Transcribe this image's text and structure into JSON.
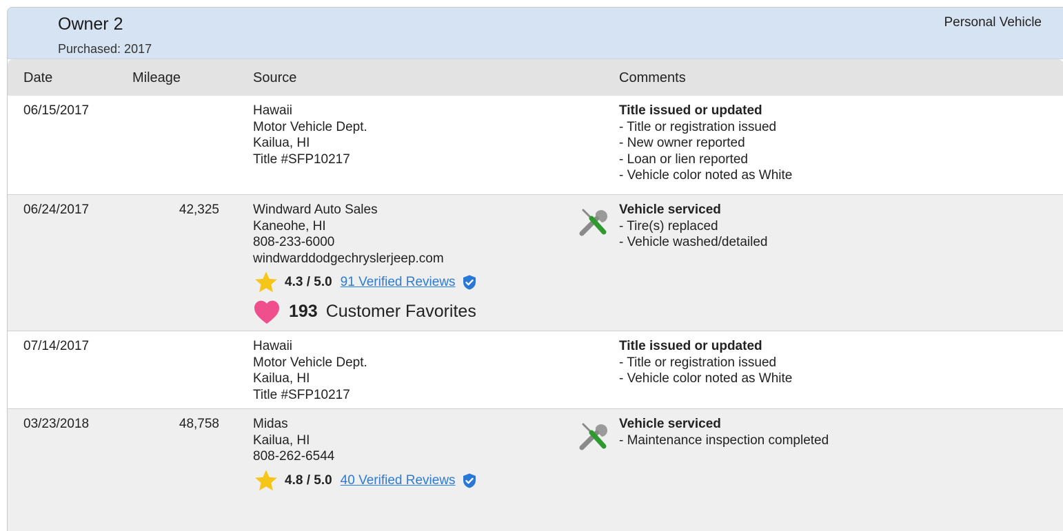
{
  "owner": {
    "title": "Owner 2",
    "purchased": "Purchased: 2017",
    "type": "Personal Vehicle"
  },
  "columns": {
    "date": "Date",
    "mileage": "Mileage",
    "source": "Source",
    "comments": "Comments"
  },
  "rows": [
    {
      "date": "06/15/2017",
      "mileage": "",
      "source": [
        "Hawaii",
        "Motor Vehicle Dept.",
        "Kailua, HI",
        "Title #SFP10217"
      ],
      "comment_title": "Title issued or updated",
      "comments": [
        "- Title or registration issued",
        "- New owner reported",
        "- Loan or lien reported",
        "- Vehicle color noted as White"
      ]
    },
    {
      "date": "06/24/2017",
      "mileage": "42,325",
      "source": [
        "Windward Auto Sales",
        "Kaneohe, HI",
        "808-233-6000",
        "windwarddodgechryslerjeep.com"
      ],
      "rating": "4.3 / 5.0",
      "reviews": "91 Verified Reviews",
      "favorites_count": "193",
      "favorites_label": "Customer Favorites",
      "comment_title": "Vehicle serviced",
      "comments": [
        "- Tire(s) replaced",
        "- Vehicle washed/detailed"
      ],
      "icon": "wrench-screwdriver-icon"
    },
    {
      "date": "07/14/2017",
      "mileage": "",
      "source": [
        "Hawaii",
        "Motor Vehicle Dept.",
        "Kailua, HI",
        "Title #SFP10217"
      ],
      "comment_title": "Title issued or updated",
      "comments": [
        "- Title or registration issued",
        "- Vehicle color noted as White"
      ]
    },
    {
      "date": "03/23/2018",
      "mileage": "48,758",
      "source": [
        "Midas",
        "Kailua, HI",
        "808-262-6544"
      ],
      "rating": "4.8 / 5.0",
      "reviews": "40 Verified Reviews",
      "comment_title": "Vehicle serviced",
      "comments": [
        "- Maintenance inspection completed"
      ],
      "icon": "wrench-screwdriver-icon"
    }
  ],
  "colors": {
    "header_bg": "#d6e3f2",
    "column_header_bg": "#e3e3e3",
    "alt_row_bg": "#efefef",
    "link": "#2c7bd1",
    "star": "#f5c518",
    "heart": "#ef4f8c",
    "shield": "#2a78d6"
  }
}
